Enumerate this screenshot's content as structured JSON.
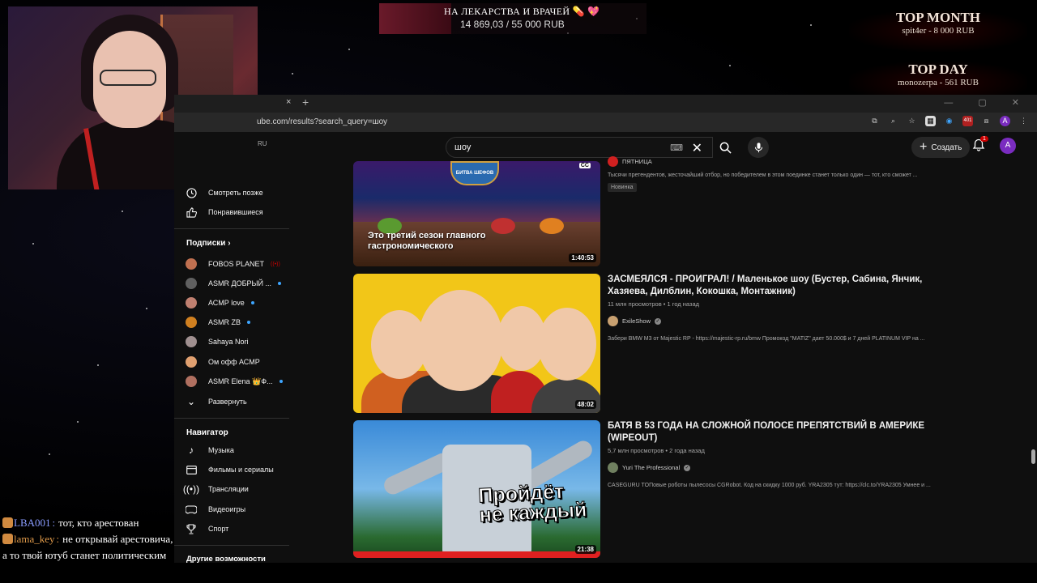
{
  "donation": {
    "title": "НА ЛЕКАРСТВА И ВРАЧЕЙ 💊 💖",
    "amount": "14 869,03 / 55 000 RUB",
    "progress_fraction": 0.27
  },
  "top_month": {
    "title": "TOP MONTH",
    "entry": "spit4er  -  8 000 RUB"
  },
  "top_day": {
    "title": "TOP DAY",
    "entry": "monozerpa  -  561 RUB"
  },
  "browser": {
    "tab_close": "×",
    "tab_new": "+",
    "window_controls": "— ▢ ✕",
    "url": "ube.com/results?search_query=шоу",
    "ext_badge": "401",
    "profile_initial": "A"
  },
  "youtube": {
    "region": "RU",
    "search_value": "шоу",
    "create_label": "Создать",
    "notif_count": "1",
    "avatar_initial": "A"
  },
  "sidebar": {
    "watch_later": "Смотреть позже",
    "liked": "Понравившиеся",
    "subscriptions_heading": "Подписки",
    "subscriptions": [
      {
        "name": "FOBOS PLANET",
        "status": "live",
        "color": "#c07050"
      },
      {
        "name": "ASMR ДОБРЫЙ ...",
        "status": "new",
        "color": "#606060"
      },
      {
        "name": "АСМР love",
        "status": "new",
        "color": "#c08070"
      },
      {
        "name": "ASMR ZB",
        "status": "new",
        "color": "#d08020"
      },
      {
        "name": "Sahaya Nori",
        "status": "",
        "color": "#a09090"
      },
      {
        "name": "Ом офф АСМР",
        "status": "",
        "color": "#e0a070"
      },
      {
        "name": "ASMR Elena 👑Ф...",
        "status": "new",
        "color": "#b07060"
      }
    ],
    "expand": "Развернуть",
    "navigator_heading": "Навигатор",
    "navigator": [
      {
        "label": "Музыка",
        "icon": "music-note-icon"
      },
      {
        "label": "Фильмы и сериалы",
        "icon": "film-icon"
      },
      {
        "label": "Трансляции",
        "icon": "live-icon"
      },
      {
        "label": "Видеоигры",
        "icon": "gamepad-icon"
      },
      {
        "label": "Спорт",
        "icon": "trophy-icon"
      }
    ],
    "more_heading": "Другие возможности"
  },
  "results": [
    {
      "channel": "ПЯТНИЦА",
      "description": "Тысячи претендентов, жесточайший отбор, но победителем в этом поединке станет только один — тот, кто сможет ...",
      "badge": "Новинка",
      "thumb_caption": "Это третий сезон главного гастрономического",
      "thumb_logo": "БИТВА ШЕФОВ",
      "cc": "CC",
      "duration": "1:40:53"
    },
    {
      "title": "ЗАСМЕЯЛСЯ - ПРОИГРАЛ! / Маленькое шоу (Бустер, Сабина, Янчик, Хазяева, Дилблин, Кокошка, Монтажник)",
      "meta": "11 млн просмотров • 1 год назад",
      "channel": "ExileShow",
      "description": "Забери BMW M3 от Majestic RP - https://majestic-rp.ru/bmw Промокод \"MATIZ\" дает 50.000$ и 7 дней PLATINUM VIP на ...",
      "duration": "48:02"
    },
    {
      "title": "БАТЯ В 53 ГОДА НА СЛОЖНОЙ ПОЛОСЕ ПРЕПЯТСТВИЙ В АМЕРИКЕ (WIPEOUT)",
      "meta": "5,7 млн просмотров • 2 года назад",
      "channel": "Yuri The Professional",
      "description": "CASEGURU TOПовые роботы пылесосы CGRobot. Код на скидку 1000 руб. YRA2305 тут: https://clc.to/YRA2305 Умнее и ...",
      "thumb_caption_1": "Пройдёт",
      "thumb_caption_2": "не каждый",
      "duration": "21:38"
    }
  ],
  "chat": [
    {
      "nick": "LBA001",
      "sep": ":",
      "text": "тот, кто арестован"
    },
    {
      "nick": "lama_key",
      "sep": ":",
      "text": "не открывай арестовича, а то твой ютуб станет политическим"
    }
  ]
}
